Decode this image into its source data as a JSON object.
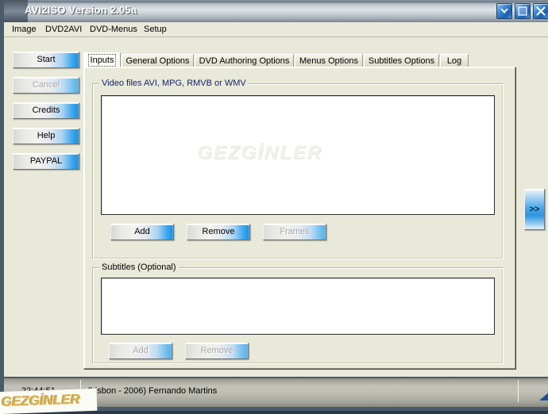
{
  "window": {
    "title": "AVI2ISO Version 2.05a",
    "controls": [
      {
        "name": "minimize",
        "icon": "chevron-down-icon"
      },
      {
        "name": "maximize",
        "icon": "maximize-icon"
      },
      {
        "name": "close",
        "icon": "close-icon"
      }
    ]
  },
  "menubar": {
    "items": [
      {
        "label": "Image"
      },
      {
        "label": "DVD2AVI"
      },
      {
        "label": "DVD-Menus"
      },
      {
        "label": "Setup"
      }
    ]
  },
  "sidebar": {
    "buttons": [
      {
        "label": "Start",
        "enabled": true
      },
      {
        "label": "Cancel",
        "enabled": false
      },
      {
        "label": "Credits",
        "enabled": true
      },
      {
        "label": "Help",
        "enabled": true
      },
      {
        "label": "PAYPAL",
        "enabled": true
      }
    ]
  },
  "tabs": {
    "active": "Inputs",
    "items": [
      {
        "label": "Inputs"
      },
      {
        "label": "General Options"
      },
      {
        "label": "DVD Authoring Options"
      },
      {
        "label": "Menus Options"
      },
      {
        "label": "Subtitles Options"
      },
      {
        "label": "Log"
      }
    ]
  },
  "inputs_tab": {
    "video_group": {
      "title": "Video files AVI,  MPG, RMVB or WMV",
      "list_items": [],
      "watermark": "GEZGİNLER",
      "buttons": [
        {
          "label": "Add",
          "enabled": true
        },
        {
          "label": "Remove",
          "enabled": true
        },
        {
          "label": "Frames",
          "enabled": false
        }
      ]
    },
    "subtitles_group": {
      "title": "Subtitles (Optional)",
      "list_items": [],
      "buttons": [
        {
          "label": "Add",
          "enabled": false
        },
        {
          "label": "Remove",
          "enabled": false
        }
      ]
    }
  },
  "expand_button": {
    "label": ">>"
  },
  "statusbar": {
    "time": "22:44:51",
    "author": "(Lisbon - 2006) Fernando Martins"
  },
  "watermark": {
    "text": "GEZGİNLER"
  },
  "colors": {
    "app_background": "#e9e9d9",
    "window_border": "#4a5a6b",
    "group_title_blue": "#16216b",
    "button_accent_blue": "#1b8ede",
    "watermark_gold": "#d2ae50"
  }
}
